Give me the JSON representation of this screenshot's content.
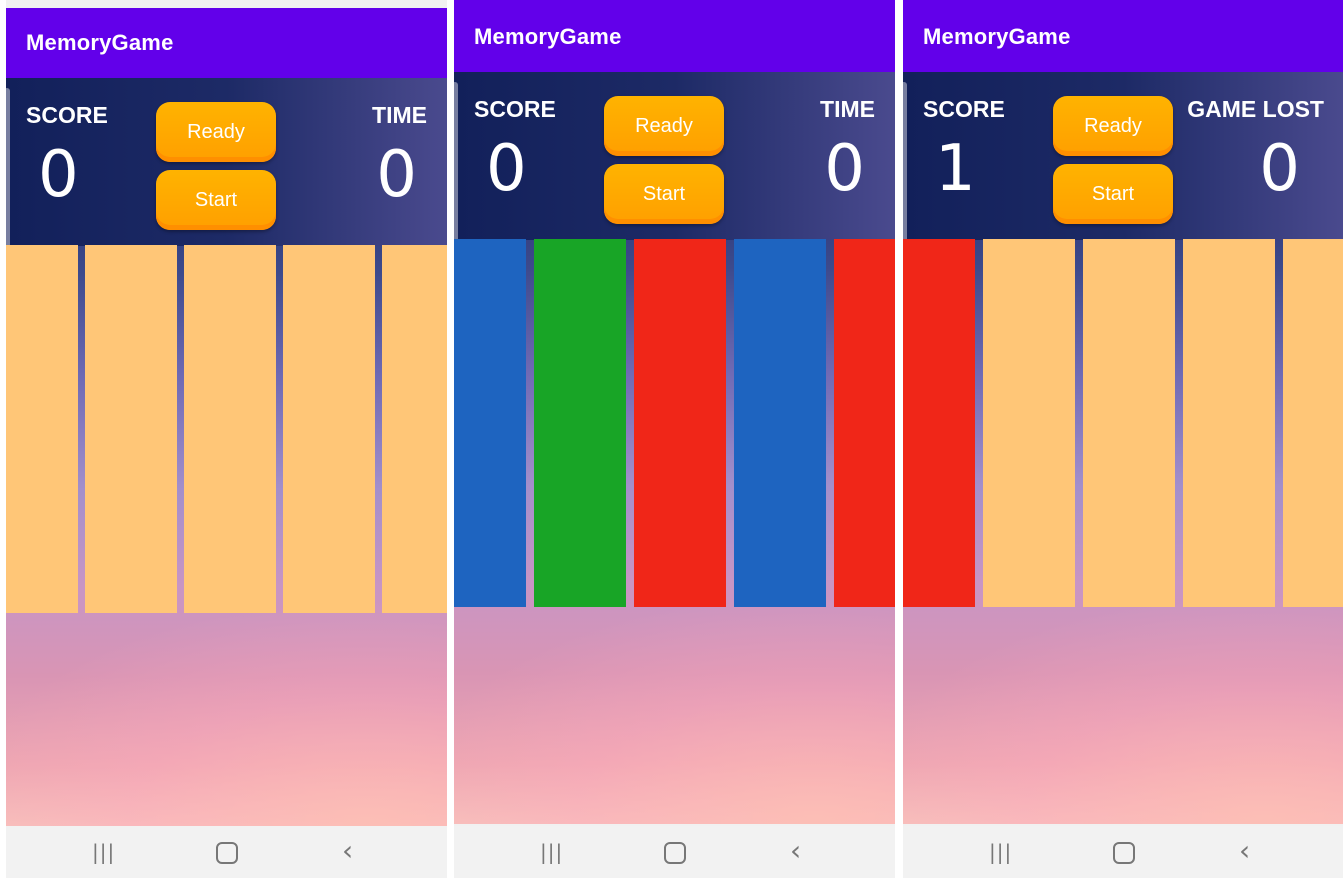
{
  "screens": [
    {
      "app_title": "MemoryGame",
      "score_label": "SCORE",
      "score_value": "0",
      "right_label": "TIME",
      "right_value": "0",
      "ready_label": "Ready",
      "start_label": "Start",
      "cards": [
        {
          "color": "#ffc677"
        },
        {
          "color": "#ffc677"
        },
        {
          "color": "#ffc677"
        },
        {
          "color": "#ffc677"
        },
        {
          "color": "#ffc677"
        }
      ]
    },
    {
      "app_title": "MemoryGame",
      "score_label": "SCORE",
      "score_value": "0",
      "right_label": "TIME",
      "right_value": "0",
      "ready_label": "Ready",
      "start_label": "Start",
      "cards": [
        {
          "color": "#1e64c0"
        },
        {
          "color": "#18a526"
        },
        {
          "color": "#f02618"
        },
        {
          "color": "#1e64c0"
        },
        {
          "color": "#f02618"
        }
      ]
    },
    {
      "app_title": "MemoryGame",
      "score_label": "SCORE",
      "score_value": "1",
      "right_label": "GAME LOST",
      "right_value": "0",
      "ready_label": "Ready",
      "start_label": "Start",
      "cards": [
        {
          "color": "#f02618"
        },
        {
          "color": "#ffc677"
        },
        {
          "color": "#ffc677"
        },
        {
          "color": "#ffc677"
        },
        {
          "color": "#ffc677"
        }
      ]
    }
  ],
  "navbar": {
    "recent_icon": "recent-apps-icon",
    "home_icon": "home-icon",
    "back_icon": "back-icon"
  }
}
